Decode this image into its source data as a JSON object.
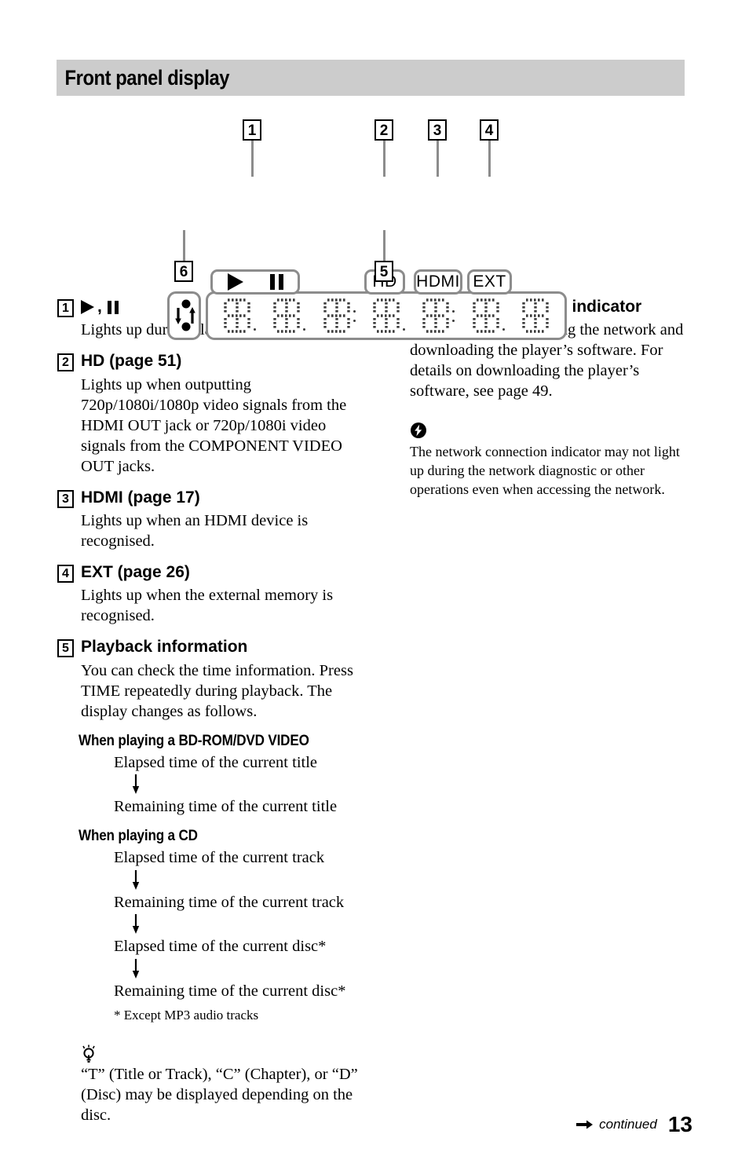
{
  "header": {
    "title": "Front panel display"
  },
  "diagram": {
    "callouts": [
      {
        "id": "1",
        "label": "1"
      },
      {
        "id": "2",
        "label": "2"
      },
      {
        "id": "3",
        "label": "3"
      },
      {
        "id": "4",
        "label": "4"
      },
      {
        "id": "5",
        "label": "5"
      },
      {
        "id": "6",
        "label": "6"
      }
    ],
    "badges": {
      "playpause": {
        "icons": [
          "play-icon",
          "pause-icon"
        ]
      },
      "hd": "HD",
      "hdmi": "HDMI",
      "ext": "EXT"
    },
    "network_indicator_icon": "network-up-down-icon",
    "lcd_cell_count": 7
  },
  "items": [
    {
      "num": "1",
      "title_symbols": true,
      "title": ",",
      "body": "Lights up during playback or pause."
    },
    {
      "num": "2",
      "title": "HD (page 51)",
      "body": "Lights up when outputting 720p/1080i/1080p video signals from the HDMI OUT jack or 720p/1080i video signals from the COMPONENT VIDEO OUT jacks."
    },
    {
      "num": "3",
      "title": "HDMI (page 17)",
      "body": "Lights up when an HDMI device is recognised."
    },
    {
      "num": "4",
      "title": "EXT (page 26)",
      "body": "Lights up when the external memory is recognised."
    },
    {
      "num": "5",
      "title": "Playback information",
      "body": "You can check the time information. Press TIME repeatedly during playback. The display changes as follows."
    }
  ],
  "flows": [
    {
      "heading": "When playing a BD-ROM/DVD VIDEO",
      "steps": [
        "Elapsed time of the current title",
        "Remaining time of the current title"
      ]
    },
    {
      "heading": "When playing a CD",
      "steps": [
        "Elapsed time of the current track",
        "Remaining time of the current track",
        "Elapsed time of the current disc*",
        "Remaining time of the current disc*"
      ],
      "footnote": "* Except MP3 audio tracks"
    }
  ],
  "tip": {
    "icon": "lightbulb-tip-icon",
    "text": "“T” (Title or Track), “C” (Chapter), or “D” (Disc) may be displayed depending on the disc."
  },
  "right_item": {
    "num": "6",
    "title": "Network connection indicator",
    "body": "Lights up when accessing the network and downloading the player’s software. For details on downloading the player’s software, see page 49."
  },
  "note": {
    "icon": "note-flash-icon",
    "text": "The network connection indicator may not light up during the network diagnostic or other operations even when accessing the network."
  },
  "footer": {
    "arrow_icon": "right-arrow-icon",
    "continued_label": "continued",
    "page_number": "13"
  }
}
